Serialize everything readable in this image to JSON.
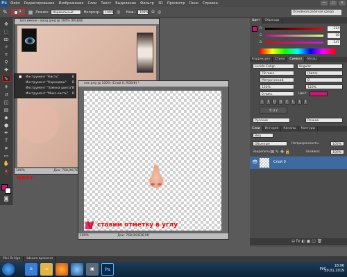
{
  "menubar": {
    "logo": "Ps",
    "items": [
      "Файл",
      "Редактирование",
      "Изображение",
      "Слои",
      "Текст",
      "Выделение",
      "Фильтр",
      "3D",
      "Просмотр",
      "Окно",
      "Справка"
    ],
    "window_controls": [
      "—",
      "□",
      "×"
    ]
  },
  "optbar": {
    "brush_size": "9",
    "mode_label": "Режим:",
    "mode_value": "Нормальный",
    "opacity_label": "Непрозр.:",
    "opacity_value": "100%",
    "flow_label": "Наж.:",
    "flow_value": "100%",
    "workspace": "Основная рабочая среда"
  },
  "doc1": {
    "tab_title": "Без имени - вход.jpeg @ 100% (RGB/8)",
    "zoom": "100%",
    "status": "Док: 768,0К/768,0К"
  },
  "flyout": {
    "items": [
      {
        "label": "Инструмент \"Кисть\"",
        "key": "B"
      },
      {
        "label": "Инструмент \"Карандаш\"",
        "key": "B"
      },
      {
        "label": "Инструмент \"Замена цвета\"",
        "key": "B"
      },
      {
        "label": "Инструмент \"Микс-кисть\"",
        "key": "B"
      }
    ]
  },
  "doc2": {
    "tab_title": "нос.png @ 100% (Слой 0, RGB/8) *",
    "zoom": "100%",
    "status": "Док: 768,0К/836,9К"
  },
  "annotations": {
    "color_note": "цвет",
    "corner_note": "ставим отметку в углу",
    "tick": "✓",
    "v_mark": "V"
  },
  "color_panel": {
    "tabs": [
      "Цвет",
      "Образцы"
    ],
    "r_label": "R",
    "r_value": "214",
    "g_label": "G",
    "g_value": "18",
    "b_label": "B",
    "b_value": "147",
    "fg_color": "#d4107a"
  },
  "char_panel": {
    "tabs": [
      "Коррекция",
      "Стили",
      "Символ",
      "Абзац"
    ],
    "font_family": "Lucida Callgr...",
    "font_style": "Regular",
    "font_size": "78 пикс.",
    "leading": "(Авто)",
    "kerning": "Метрический",
    "tracking": "0",
    "vscale": "120%",
    "hscale": "110%",
    "baseline": "0 пикс.",
    "color_label": "Цвет:",
    "lang": "Русский",
    "aa": "Резкое",
    "fmt_buttons": [
      "T",
      "T",
      "TT",
      "Tt",
      "T'",
      "T,",
      "T",
      "T"
    ]
  },
  "layers_panel": {
    "tabs": [
      "Слои",
      "История",
      "Каналы",
      "Контуры"
    ],
    "kind": "Вид",
    "blend": "Обычные",
    "opacity_label": "Непрозрачность:",
    "opacity": "100%",
    "lock_label": "Закрепить:",
    "fill_label": "Заливка:",
    "fill": "100%",
    "layer_name": "Слой 0"
  },
  "minibar": [
    "Mini Bridge",
    "Шкала времени"
  ],
  "taskbar": {
    "lang": "РУС",
    "time": "18:06",
    "date": "20.01.2019",
    "ps_label": "Ps"
  }
}
